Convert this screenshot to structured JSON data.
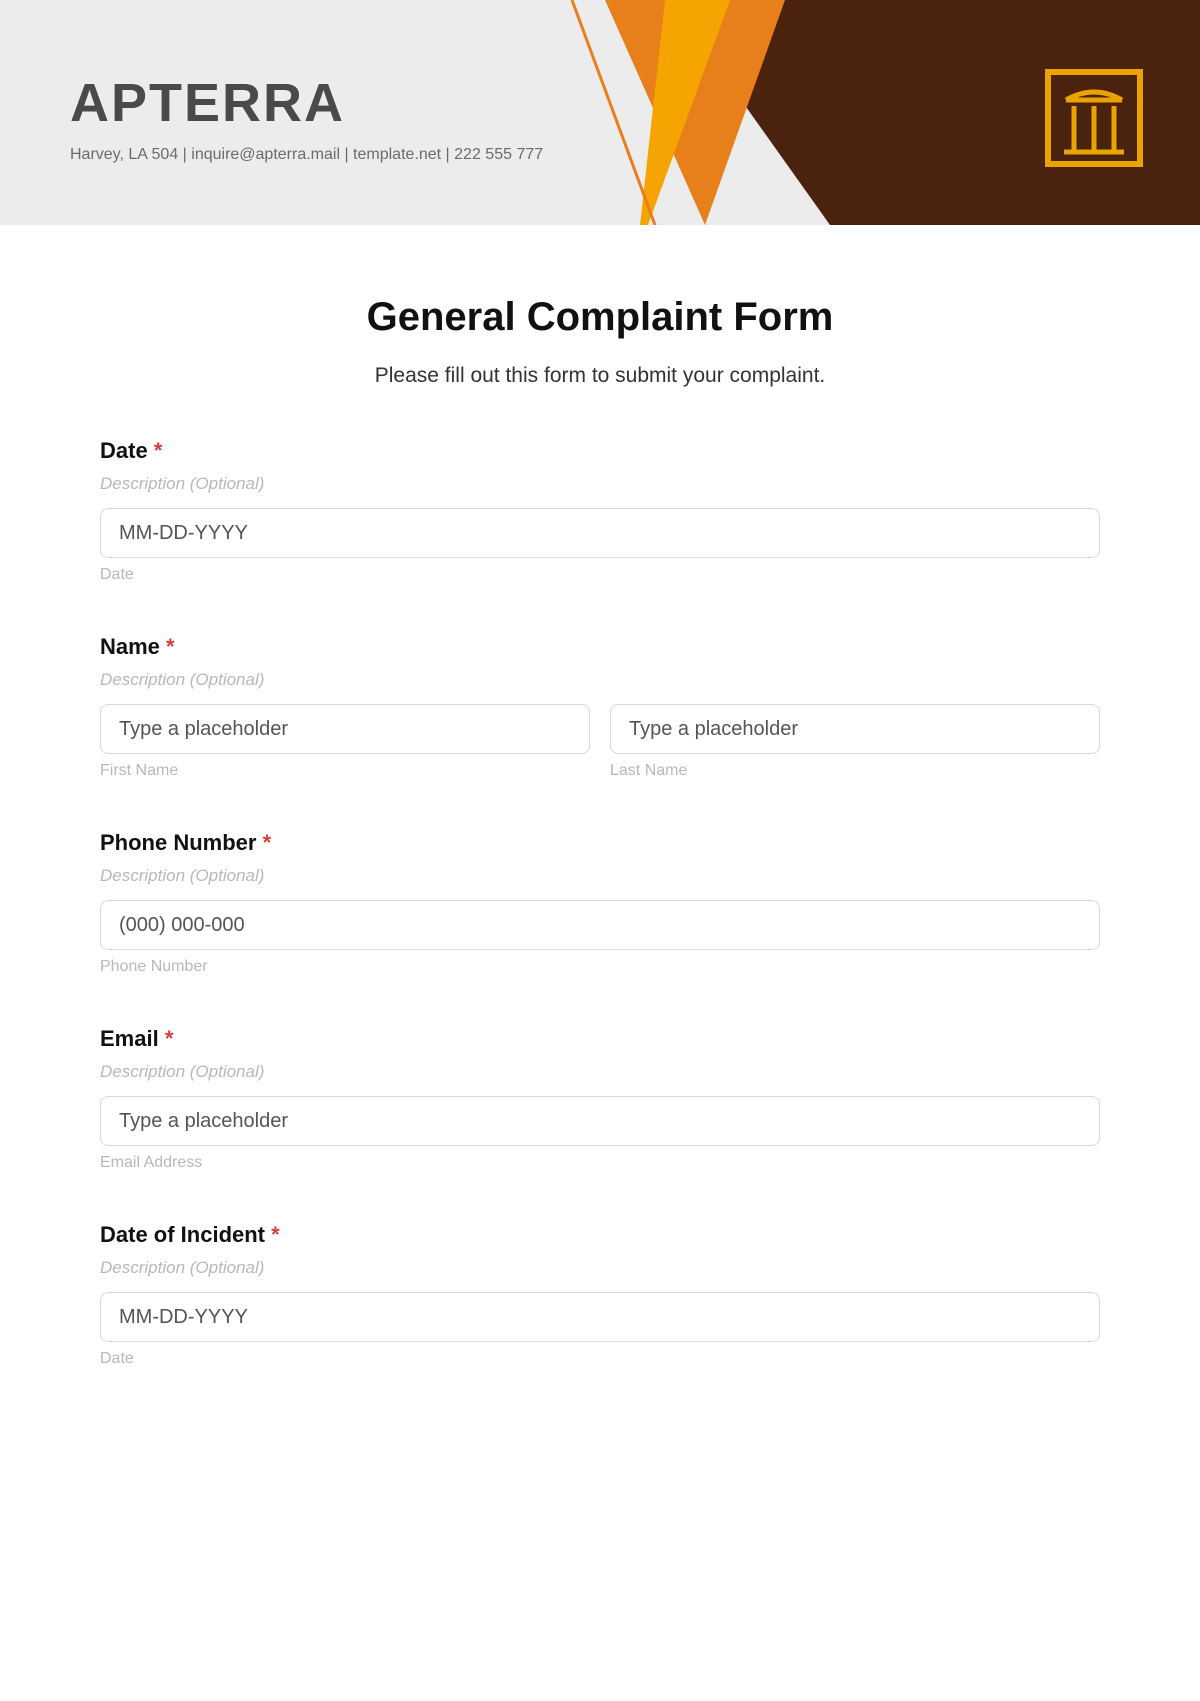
{
  "header": {
    "brand": "APTERRA",
    "contact": "Harvey, LA 504 | inquire@apterra.mail | template.net | 222 555 777"
  },
  "form": {
    "title": "General Complaint Form",
    "subtitle": "Please fill out this form to submit your complaint.",
    "required_mark": "*",
    "fields": {
      "date": {
        "label": "Date",
        "desc": "Description (Optional)",
        "placeholder": "MM-DD-YYYY",
        "sublabel": "Date"
      },
      "name": {
        "label": "Name",
        "desc": "Description (Optional)",
        "first_placeholder": "Type a placeholder",
        "first_sublabel": "First Name",
        "last_placeholder": "Type a placeholder",
        "last_sublabel": "Last Name"
      },
      "phone": {
        "label": "Phone Number",
        "desc": "Description (Optional)",
        "placeholder": "(000) 000-000",
        "sublabel": "Phone Number"
      },
      "email": {
        "label": "Email",
        "desc": "Description (Optional)",
        "placeholder": "Type a placeholder",
        "sublabel": "Email Address"
      },
      "incident": {
        "label": "Date of Incident",
        "desc": "Description (Optional)",
        "placeholder": "MM-DD-YYYY",
        "sublabel": "Date"
      }
    }
  }
}
